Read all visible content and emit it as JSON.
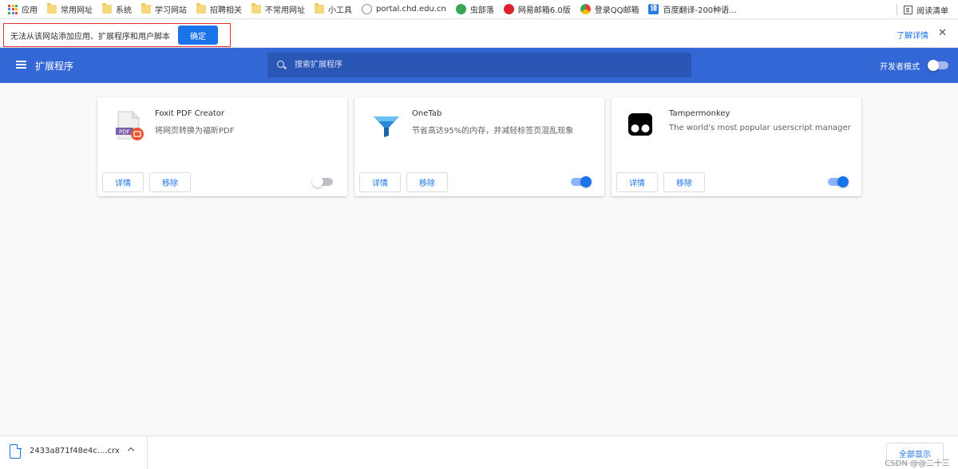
{
  "bookmarks": {
    "items": [
      {
        "label": "应用",
        "icon": "apps-icon"
      },
      {
        "label": "常用网址",
        "icon": "folder-icon"
      },
      {
        "label": "系统",
        "icon": "folder-icon"
      },
      {
        "label": "学习网站",
        "icon": "folder-icon"
      },
      {
        "label": "招聘相关",
        "icon": "folder-icon"
      },
      {
        "label": "不常用网址",
        "icon": "folder-icon"
      },
      {
        "label": "小工具",
        "icon": "folder-icon"
      },
      {
        "label": "portal.chd.edu.cn",
        "icon": "globe-icon"
      },
      {
        "label": "虫部落",
        "icon": "chongbuluo-icon"
      },
      {
        "label": "网易邮箱6.0版",
        "icon": "netease-mail-icon"
      },
      {
        "label": "登录QQ邮箱",
        "icon": "chrome-icon"
      },
      {
        "label": "百度翻译-200种语...",
        "icon": "baidu-translate-icon"
      }
    ],
    "reading_list": "阅读清单"
  },
  "infobar": {
    "message": "无法从该网站添加应用、扩展程序和用户脚本",
    "confirm": "确定",
    "learn_more": "了解详情",
    "close": "✕",
    "highlight_color": "#e03030"
  },
  "header": {
    "title": "扩展程序",
    "search_placeholder": "搜索扩展程序",
    "developer_mode": "开发者模式",
    "developer_mode_enabled": false,
    "background_color": "#3367d6"
  },
  "extensions": [
    {
      "name": "Foxit PDF Creator",
      "description": "将网页转换为福昕PDF",
      "details": "详情",
      "remove": "移除",
      "enabled": false,
      "icon": "foxit-pdf-icon",
      "icon_badge": "PDF"
    },
    {
      "name": "OneTab",
      "description": "节省高达95%的内存，并减轻标签页混乱现象",
      "details": "详情",
      "remove": "移除",
      "enabled": true,
      "icon": "onetab-funnel-icon"
    },
    {
      "name": "Tampermonkey",
      "description": "The world's most popular userscript manager",
      "details": "详情",
      "remove": "移除",
      "enabled": true,
      "icon": "tampermonkey-icon"
    }
  ],
  "download": {
    "filename": "2433a871f48e4c....crx",
    "show_all": "全部显示"
  },
  "watermark": "CSDN @@二十三",
  "accent_color": "#1a73e8"
}
